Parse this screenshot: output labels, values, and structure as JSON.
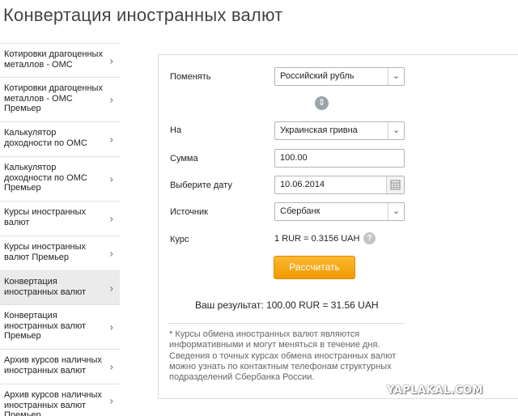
{
  "page": {
    "title": "Конвертация иностранных валют"
  },
  "sidebar": {
    "items": [
      {
        "label": "Котировки драгоценных металлов - ОМС"
      },
      {
        "label": "Котировки драгоценных металлов - ОМС Премьер"
      },
      {
        "label": "Калькулятор доходности по ОМС"
      },
      {
        "label": "Калькулятор доходности по ОМС Премьер"
      },
      {
        "label": "Курсы иностранных валют"
      },
      {
        "label": "Курсы иностранных валют Премьер"
      },
      {
        "label": "Конвертация иностранных валют"
      },
      {
        "label": "Конвертация иностранных валют Премьер"
      },
      {
        "label": "Архив курсов наличных иностранных валют"
      },
      {
        "label": "Архив курсов наличных иностранных валют Премьер"
      }
    ],
    "active_index": 6
  },
  "form": {
    "from_label": "Поменять",
    "from_value": "Российский рубль",
    "to_label": "На",
    "to_value": "Украинская гривна",
    "amount_label": "Сумма",
    "amount_value": "100.00",
    "date_label": "Выберите дату",
    "date_value": "10.06.2014",
    "source_label": "Источник",
    "source_value": "Сбербанк",
    "rate_label": "Курс",
    "rate_value": "1 RUR = 0.3156 UAH",
    "calc_button": "Рассчитать",
    "result": "Ваш результат: 100.00 RUR = 31.56 UAH",
    "note": "* Курсы обмена иностранных валют являются информативными и могут меняться в течение дня. Сведения о точных курсах обмена иностранных валют можно узнать по контактным телефонам структурных подразделений Сбербанка России."
  },
  "watermark": "YAPLAKAL.COM"
}
